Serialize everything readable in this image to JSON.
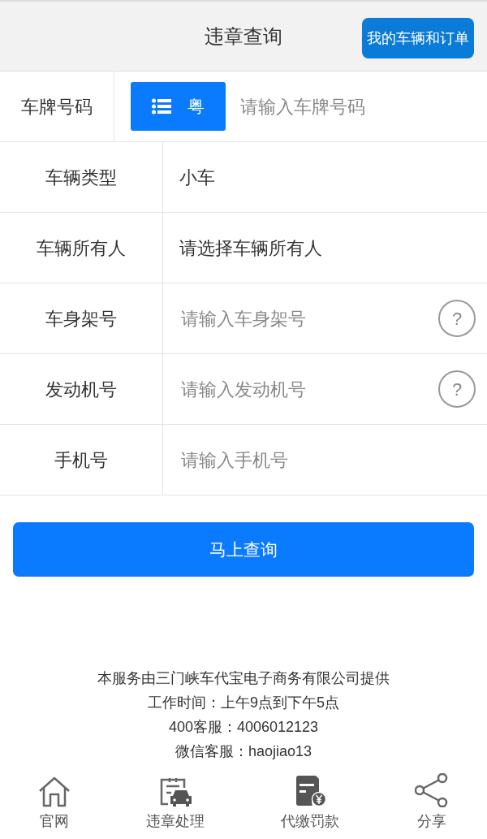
{
  "header": {
    "title": "违章查询",
    "action": "我的车辆和订单"
  },
  "form": [
    {
      "kind": "plate",
      "label": "车牌号码",
      "province": "粤",
      "placeholder": "请输入车牌号码"
    },
    {
      "kind": "select",
      "label": "车辆类型",
      "value": "小车"
    },
    {
      "kind": "select",
      "label": "车辆所有人",
      "value": "请选择车辆所有人"
    },
    {
      "kind": "input",
      "label": "车身架号",
      "placeholder": "请输入车身架号",
      "help": "?"
    },
    {
      "kind": "input",
      "label": "发动机号",
      "placeholder": "请输入发动机号",
      "help": "?"
    },
    {
      "kind": "input",
      "label": "手机号",
      "placeholder": "请输入手机号"
    }
  ],
  "submit": "马上查询",
  "footer": [
    "本服务由三门峡车代宝电子商务有限公司提供",
    "工作时间：上午9点到下午5点",
    "400客服：4006012123",
    "微信客服：haojiao13"
  ],
  "tabbar": [
    {
      "kind": "home",
      "label": "官网"
    },
    {
      "kind": "violation",
      "label": "违章处理"
    },
    {
      "kind": "fine",
      "label": "代缴罚款"
    },
    {
      "kind": "share",
      "label": "分享"
    }
  ]
}
